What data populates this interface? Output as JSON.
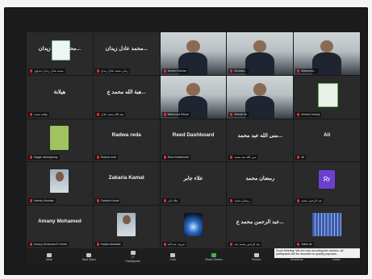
{
  "tiles": [
    {
      "big": "محمد عادل زيدان...",
      "label": "محمد عادل زيدان جيداوي",
      "kind": "logo"
    },
    {
      "big": "محمد عادل زيدان...",
      "label": "زيدان محمد عادل زيدان",
      "kind": "text"
    },
    {
      "big": "",
      "label": "Ahmed Sarhan",
      "kind": "video"
    },
    {
      "big": "",
      "label": "Mostafa...",
      "kind": "video"
    },
    {
      "big": "",
      "label": "Mahmoud...",
      "kind": "video"
    },
    {
      "big": "هيلانة",
      "label": "هيلانة محمد",
      "kind": "text"
    },
    {
      "big": "هبة الله محمد ع...",
      "label": "هبة الله محمد عادل",
      "kind": "text"
    },
    {
      "big": "",
      "label": "Mahmoud Elkhat",
      "kind": "video",
      "active": true
    },
    {
      "big": "",
      "label": "Zeinab Ali",
      "kind": "video"
    },
    {
      "big": "",
      "label": "Ahmed Hamdy",
      "kind": "sheet"
    },
    {
      "big": "",
      "label": "Nagah Abdelghany",
      "kind": "cartoon"
    },
    {
      "big": "Radwa reda",
      "label": "Radwa reda",
      "kind": "text"
    },
    {
      "big": "Reed Dashboard",
      "label": "Reed Dashboard",
      "kind": "text"
    },
    {
      "big": "منى الله عبد محمد...",
      "label": "منى الله عبد محمد",
      "kind": "text"
    },
    {
      "big": "Ali",
      "label": "Ali",
      "kind": "text"
    },
    {
      "big": "",
      "label": "Hamdy Mostafa",
      "kind": "person"
    },
    {
      "big": "Zakaria Kamal",
      "label": "Zakaria Kamal",
      "kind": "text"
    },
    {
      "big": "علاء جابر",
      "label": "علاء جابر",
      "kind": "text"
    },
    {
      "big": "رمضان محمد",
      "label": "رمضان محمد",
      "kind": "text"
    },
    {
      "big": "",
      "label": "عبد الرحمن محمد",
      "kind": "avatar",
      "avatar": "Rr"
    },
    {
      "big": "Amany Mohamed",
      "label": "Amany Mohamed El Deeb",
      "kind": "text"
    },
    {
      "big": "",
      "label": "Haidar Abdallah",
      "kind": "person2"
    },
    {
      "big": "",
      "label": "شريف عبد الله",
      "kind": "space"
    },
    {
      "big": "عبد الرحمن محمد ع...",
      "label": "عبد الرحمن محمد عبد",
      "kind": "text"
    },
    {
      "big": "",
      "label": "Saleh Ali",
      "kind": "solar"
    }
  ],
  "toolbar": [
    {
      "label": "Mute",
      "icon": "microphone-icon"
    },
    {
      "label": "Start Video",
      "icon": "camera-icon"
    },
    {
      "label": "Participants",
      "icon": "participants-icon",
      "count": "27"
    },
    {
      "label": "Chat",
      "icon": "chat-icon"
    },
    {
      "label": "Share Screen",
      "icon": "share-screen-icon",
      "green": true
    },
    {
      "label": "Record",
      "icon": "record-icon"
    },
    {
      "label": "Reactions",
      "icon": "reactions-icon"
    },
    {
      "label": "Leave",
      "icon": "leave-icon"
    }
  ],
  "notice": "Zoom Meeting: We are now recording this session. All participants will be recorded for quality purposes.",
  "colors": {
    "active": "#8fbf2f",
    "mute": "#e02d2d",
    "share": "#43b14c"
  }
}
